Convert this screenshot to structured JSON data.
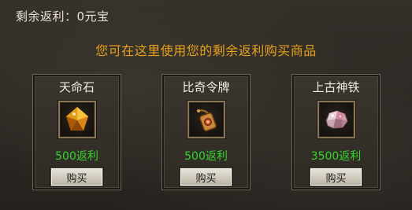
{
  "rebate": {
    "label": "剩余返利：",
    "value": "0元宝"
  },
  "hint": "您可在这里使用您的剩余返利购买商品",
  "items": [
    {
      "name": "天命石",
      "price": "500返利",
      "buy_label": "购买",
      "icon": "amber-stone-icon"
    },
    {
      "name": "比奇令牌",
      "price": "500返利",
      "buy_label": "购买",
      "icon": "bichi-token-icon"
    },
    {
      "name": "上古神铁",
      "price": "3500返利",
      "buy_label": "购买",
      "icon": "ancient-iron-ore-icon"
    }
  ],
  "colors": {
    "hint": "#e7a21a",
    "price": "#33d62b",
    "text": "#f1ebe0"
  }
}
